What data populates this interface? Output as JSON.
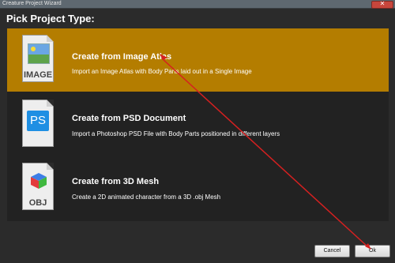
{
  "window": {
    "title": "Creature Project Wizard"
  },
  "heading": "Pick Project Type:",
  "options": [
    {
      "title": "Create from Image Atlas",
      "description": "Import an Image Atlas with Body Parts laid out in a Single Image",
      "icon_label": "IMAGE",
      "icon": "image-file-icon",
      "selected": true
    },
    {
      "title": "Create from PSD Document",
      "description": "Import a Photoshop PSD File with Body Parts positioned in different layers",
      "icon_label": "PS",
      "icon": "psd-file-icon",
      "selected": false
    },
    {
      "title": "Create from 3D Mesh",
      "description": "Create a 2D animated character from a 3D .obj Mesh",
      "icon_label": "OBJ",
      "icon": "obj-file-icon",
      "selected": false
    }
  ],
  "buttons": {
    "cancel": "Cancel",
    "ok": "Ok"
  },
  "colors": {
    "selected": "#b47d00",
    "panel": "#222222",
    "background": "#2b2b2b",
    "annotation_arrow": "#d62020"
  }
}
